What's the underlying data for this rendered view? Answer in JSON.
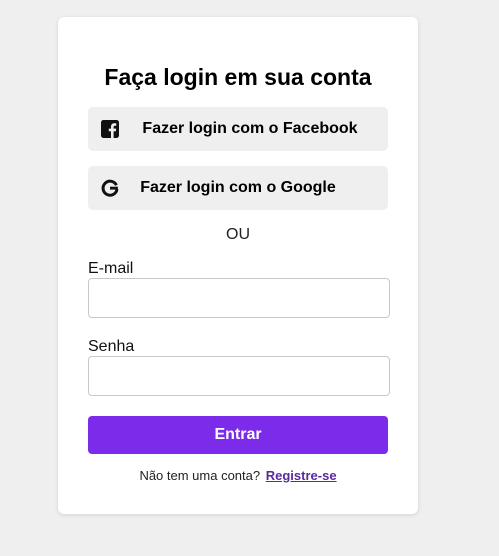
{
  "login": {
    "title": "Faça login em sua conta",
    "facebook_label": "Fazer login com o Facebook",
    "google_label": "Fazer login com o Google",
    "divider": "OU",
    "email_label": "E-mail",
    "email_value": "",
    "password_label": "Senha",
    "password_value": "",
    "submit_label": "Entrar",
    "footer_prompt": "Não tem uma conta?",
    "register_link": "Registre-se"
  },
  "colors": {
    "page_background": "#efefef",
    "card_background": "#ffffff",
    "social_button_background": "#efefef",
    "primary_button": "#7b2be9",
    "link": "#5a2a9c"
  },
  "icons": {
    "facebook": "facebook-icon",
    "google": "google-icon"
  }
}
